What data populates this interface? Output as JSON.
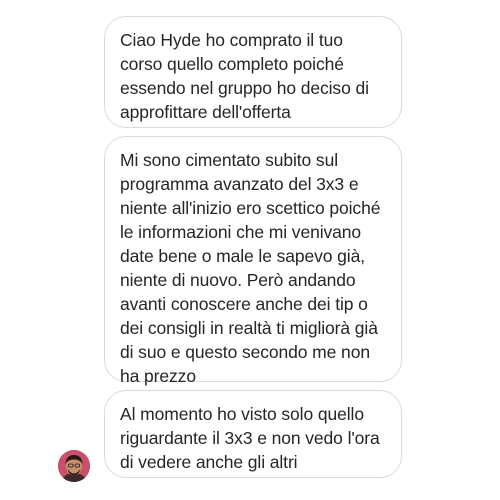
{
  "conversation": {
    "messages": [
      {
        "text": "Ciao Hyde ho comprato il tuo\ncorso quello completo poiché\nessendo nel gruppo ho deciso di\napprofittare dell'offerta"
      },
      {
        "text": "Mi sono cimentato subito sul\nprogramma avanzato del 3x3 e\nniente all'inizio ero scettico poiché\nle informazioni che mi venivano\ndate bene o male le sapevo già,\nniente di nuovo. Però andando\navanti conoscere anche dei tip o\ndei consigli in realtà ti migliorà già\ndi suo e questo secondo me non\nha prezzo"
      },
      {
        "text": "Al momento ho visto solo quello\nriguardante il 3x3 e non vedo l'ora\ndi vedere anche gli altri"
      }
    ],
    "sender_avatar": {
      "icon": "user-avatar-photo",
      "background_color": "#c9506a",
      "skin_color": "#c98f6a",
      "hair_color": "#2a1a12"
    },
    "colors": {
      "bubble_border": "#dbdbdb",
      "bubble_background": "#ffffff",
      "text": "#262626"
    }
  }
}
